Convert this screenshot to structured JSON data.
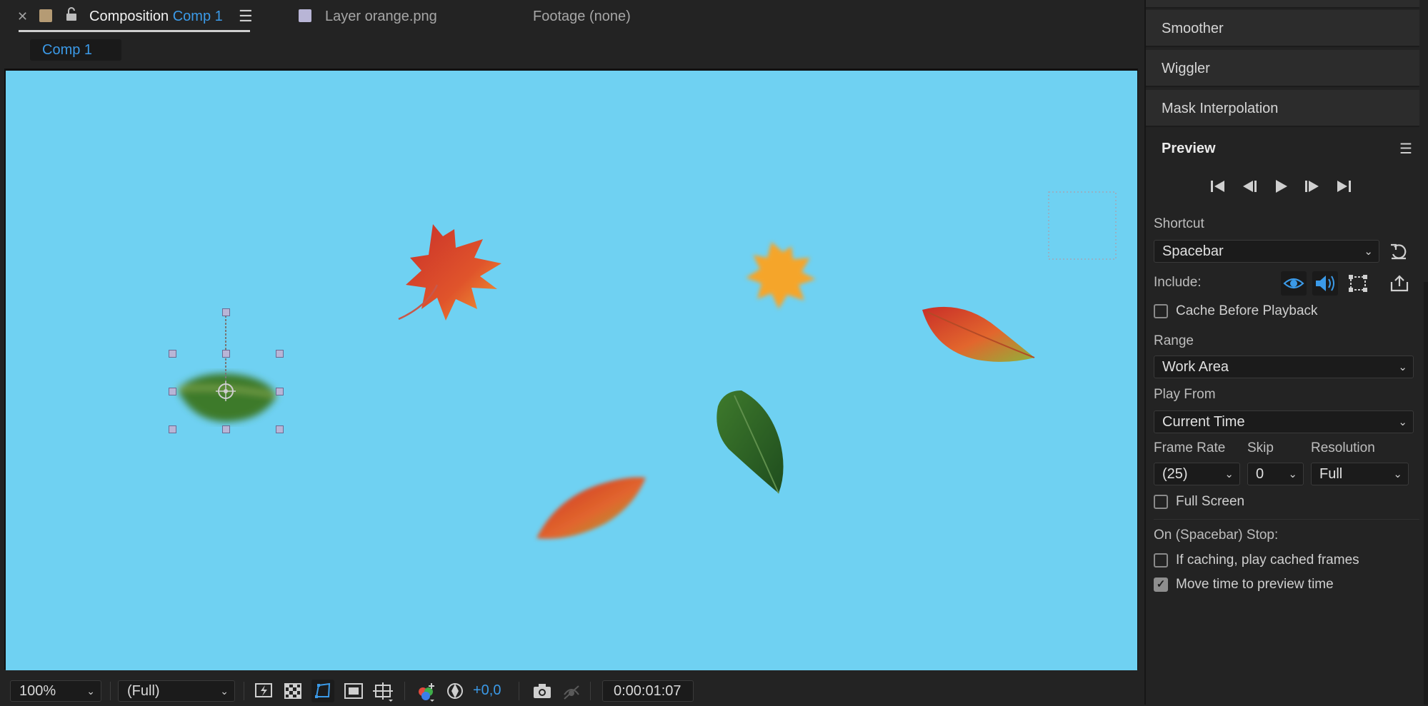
{
  "tabs": {
    "composition_label": "Composition",
    "composition_name": "Comp 1",
    "layer_tab": "Layer orange.png",
    "footage_tab": "Footage (none)",
    "sub_tab": "Comp 1"
  },
  "colors": {
    "canvas_bg": "#6fd1f2",
    "accent_blue": "#3b9ae8",
    "panel_bg": "#232323"
  },
  "viewer_bar": {
    "zoom": "100%",
    "resolution": "(Full)",
    "exposure": "+0,0",
    "timecode": "0:00:01:07"
  },
  "right_panel": {
    "effects": [
      "Smoother",
      "Wiggler",
      "Mask Interpolation"
    ],
    "preview": {
      "title": "Preview",
      "shortcut_label": "Shortcut",
      "shortcut_value": "Spacebar",
      "include_label": "Include:",
      "cache_before_playback": "Cache Before Playback",
      "range_label": "Range",
      "range_value": "Work Area",
      "play_from_label": "Play From",
      "play_from_value": "Current Time",
      "frame_rate_label": "Frame Rate",
      "frame_rate_value": "(25)",
      "skip_label": "Skip",
      "skip_value": "0",
      "resolution_label": "Resolution",
      "resolution_value": "Full",
      "full_screen": "Full Screen",
      "on_stop_label": "On (Spacebar) Stop:",
      "if_caching": "If caching, play cached frames",
      "move_time": "Move time to preview time"
    }
  }
}
